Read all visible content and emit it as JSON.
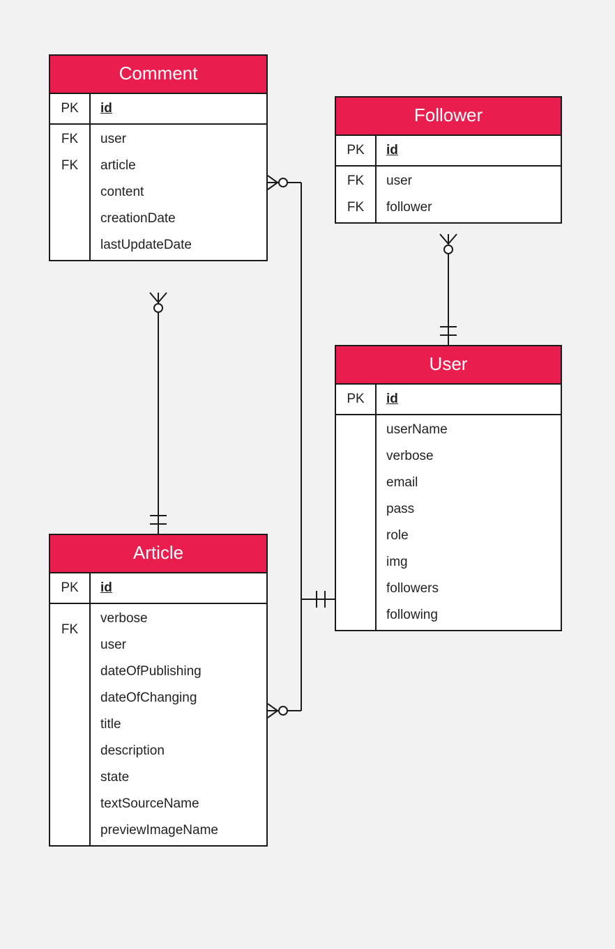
{
  "colors": {
    "header": "#e91e4f",
    "border": "#1a1a1a",
    "bg": "#f2f2f2"
  },
  "entities": {
    "comment": {
      "title": "Comment",
      "pk_label": "PK",
      "pk_field": "id",
      "keys": [
        "FK",
        "FK",
        "",
        "",
        ""
      ],
      "attrs": [
        "user",
        "article",
        "content",
        "creationDate",
        "lastUpdateDate"
      ]
    },
    "follower": {
      "title": "Follower",
      "pk_label": "PK",
      "pk_field": "id",
      "keys": [
        "FK",
        "FK"
      ],
      "attrs": [
        "user",
        "follower"
      ]
    },
    "article": {
      "title": "Article",
      "pk_label": "PK",
      "pk_field": "id",
      "keys": [
        "",
        "FK",
        "",
        "",
        "",
        "",
        "",
        "",
        ""
      ],
      "attrs": [
        "verbose",
        "user",
        "dateOfPublishing",
        "dateOfChanging",
        "title",
        "description",
        "state",
        "textSourceName",
        "previewImageName"
      ]
    },
    "user": {
      "title": "User",
      "pk_label": "PK",
      "pk_field": "id",
      "keys": [
        "",
        "",
        "",
        "",
        "",
        "",
        "",
        ""
      ],
      "attrs": [
        "userName",
        "verbose",
        "email",
        "pass",
        "role",
        "img",
        "followers",
        "following"
      ]
    }
  },
  "relationships": [
    {
      "from": "comment",
      "to": "article",
      "type": "many-to-one"
    },
    {
      "from": "comment",
      "to": "user",
      "type": "many-to-one"
    },
    {
      "from": "article",
      "to": "user",
      "type": "many-to-one"
    },
    {
      "from": "follower",
      "to": "user",
      "type": "many-to-one"
    }
  ]
}
